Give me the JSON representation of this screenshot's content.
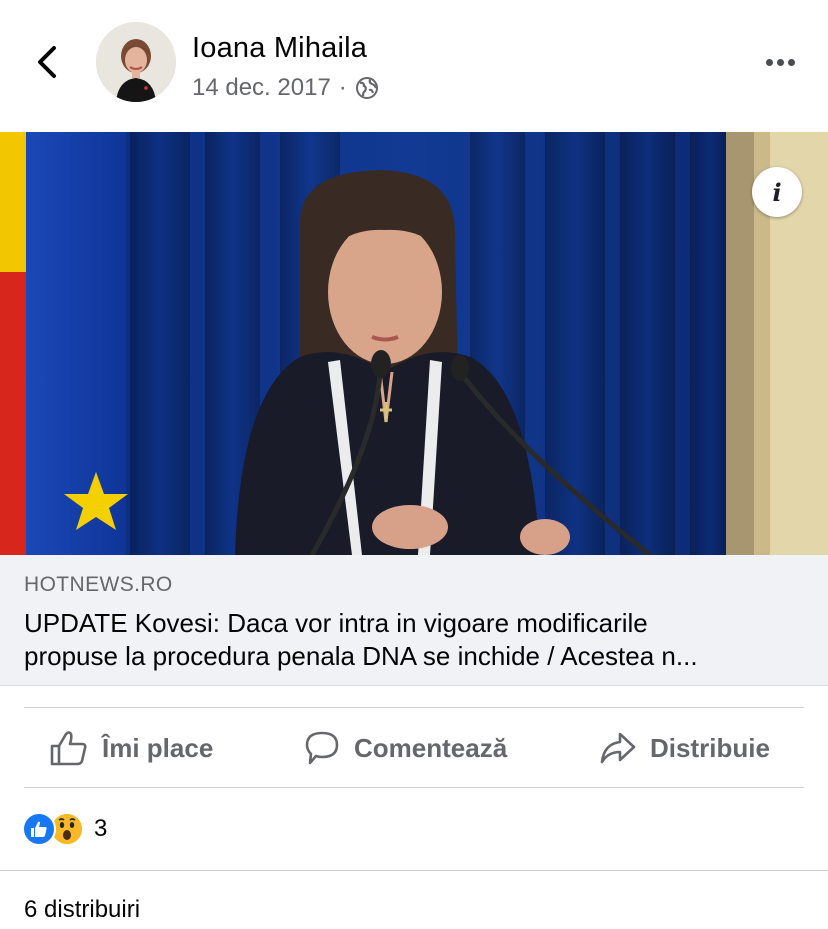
{
  "post": {
    "author": "Ioana Mihaila",
    "date": "14 dec. 2017",
    "separator": "·",
    "privacy_icon": "globe-icon"
  },
  "header": {
    "back_icon": "chevron-left-icon",
    "more_icon": "more-dots-icon"
  },
  "link_preview": {
    "domain": "HOTNEWS.RO",
    "title_line1": "UPDATE Kovesi: Daca vor intra in vigoare modificarile",
    "title_line2": "propuse la procedura penala DNA se inchide / Acestea n..."
  },
  "actions": {
    "like_label": "Îmi place",
    "comment_label": "Comentează",
    "share_label": "Distribuie"
  },
  "reactions": {
    "count": "3",
    "types": [
      "like",
      "wow"
    ]
  },
  "shares": {
    "text": "6 distribuiri"
  },
  "colors": {
    "facebook_blue": "#1877f2",
    "wow_yellow": "#f7b928",
    "secondary_text": "#65676b",
    "link_bg": "#f0f2f5"
  }
}
